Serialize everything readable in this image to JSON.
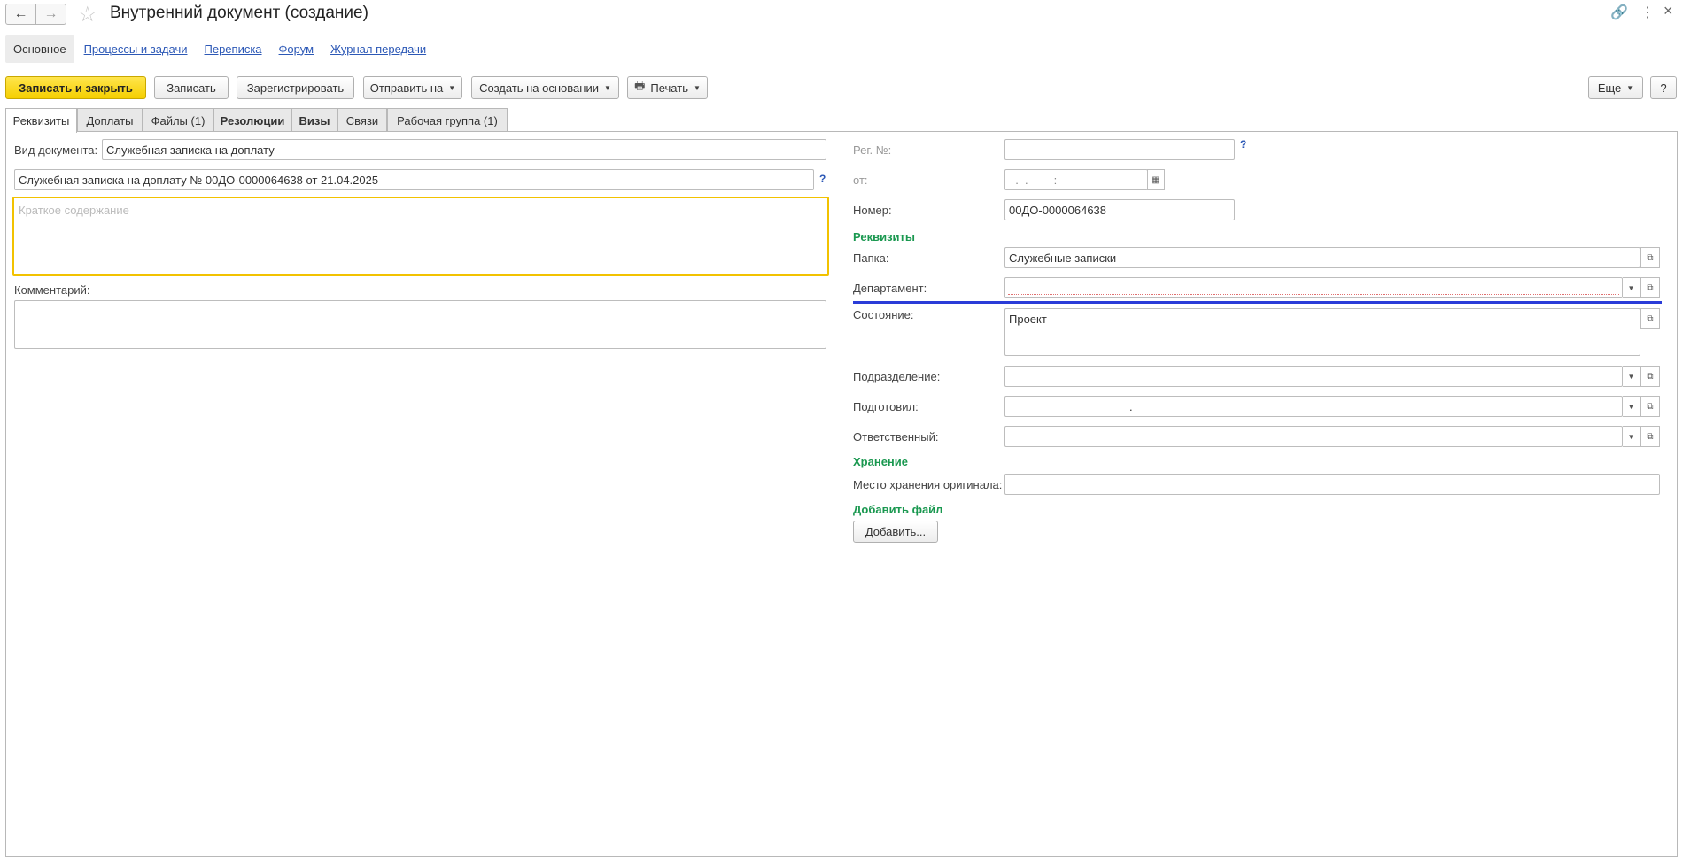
{
  "window": {
    "title": "Внутренний документ (создание)",
    "back_icon": "←",
    "forward_icon": "→",
    "star_icon": "☆",
    "link_icon": "🔗",
    "more_icon": "⋮",
    "close_icon": "×"
  },
  "section_links": [
    "Основное",
    "Процессы и задачи",
    "Переписка",
    "Форум",
    "Журнал передачи"
  ],
  "toolbar": {
    "save_close": "Записать и закрыть",
    "save": "Записать",
    "register": "Зарегистрировать",
    "send_to": "Отправить на",
    "create_based": "Создать на основании",
    "print": "Печать",
    "more": "Еще",
    "help": "?",
    "printer_icon": "🖶",
    "caret": "▼"
  },
  "tabs": [
    "Реквизиты",
    "Доплаты",
    "Файлы (1)",
    "Резолюции",
    "Визы",
    "Связи",
    "Рабочая группа (1)"
  ],
  "left": {
    "doc_type_label": "Вид документа:",
    "doc_type_value": "Служебная записка на доплату",
    "title_value": "Служебная записка на доплату № 00ДО-0000064638 от 21.04.2025",
    "title_help": "?",
    "summary_placeholder": "Краткое содержание",
    "comment_label": "Комментарий:"
  },
  "right": {
    "reg_no_label": "Рег. №:",
    "reg_help": "?",
    "from_label": "от:",
    "date_mask": "  .  .        :",
    "calendar_icon": "▦",
    "number_label": "Номер:",
    "number_value": "00ДО-0000064638",
    "requisites_header": "Реквизиты",
    "folder_label": "Папка:",
    "folder_value": "Служебные записки",
    "department_label": "Департамент:",
    "state_label": "Состояние:",
    "state_value": "Проект",
    "subdivision_label": "Подразделение:",
    "prepared_label": "Подготовил:",
    "prepared_value": ".",
    "responsible_label": "Ответственный:",
    "storage_header": "Хранение",
    "storage_place_label": "Место хранения оригинала:",
    "add_file_header": "Добавить файл",
    "add_button": "Добавить...",
    "open_icon": "⧉",
    "dropdown_icon": "▼"
  }
}
